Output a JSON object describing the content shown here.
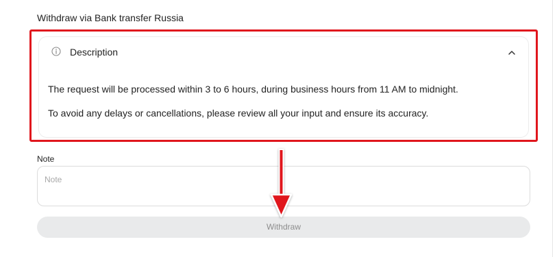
{
  "page": {
    "title": "Withdraw via Bank transfer Russia"
  },
  "description": {
    "title": "Description",
    "icon": "info-icon",
    "toggle_icon": "chevron-up-icon",
    "expanded": true,
    "lines": [
      "The request will be processed within 3 to 6 hours, during business hours from 11 AM to midnight.",
      "To avoid any delays or cancellations, please review all your input and ensure its accuracy."
    ]
  },
  "note": {
    "label": "Note",
    "placeholder": "Note",
    "value": ""
  },
  "withdraw": {
    "label": "Withdraw",
    "disabled": true
  },
  "annotations": {
    "highlight_color": "#e0161d",
    "arrow_color": "#e0161d"
  }
}
